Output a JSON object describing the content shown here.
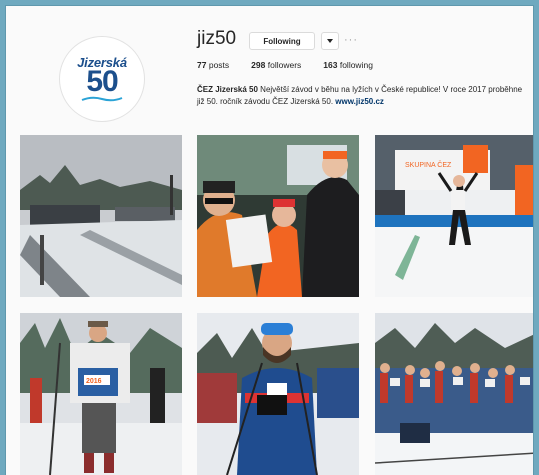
{
  "profile": {
    "username": "jiz50",
    "follow_label": "Following",
    "more_label": "···",
    "avatar_logo_top": "Jizerská",
    "avatar_logo_num": "50",
    "posts_count": "77",
    "posts_label": "posts",
    "followers_count": "298",
    "followers_label": "followers",
    "following_count": "163",
    "following_label": "following",
    "bio_name": "ČEZ Jizerská 50",
    "bio_text": " Největší závod v běhu na lyžích v České republice! V roce 2017 proběhne již 50. ročník závodu ČEZ Jizerská 50. ",
    "bio_link": "www.jiz50.cz"
  },
  "photos": [
    {
      "label": "Snowy stadium with empty ski tracks"
    },
    {
      "label": "Skier receiving a certificate"
    },
    {
      "label": "Winner crossing the finish line",
      "banner": "SKUPINA ČEZ"
    },
    {
      "label": "Retro skier with bib",
      "bib": "2016"
    },
    {
      "label": "Skier with beard and hat"
    },
    {
      "label": "Crowd of skiers at the finish area"
    }
  ],
  "colors": {
    "accent": "#1c4f8c",
    "cez_orange": "#f26522",
    "background": "#6fa9bf"
  }
}
